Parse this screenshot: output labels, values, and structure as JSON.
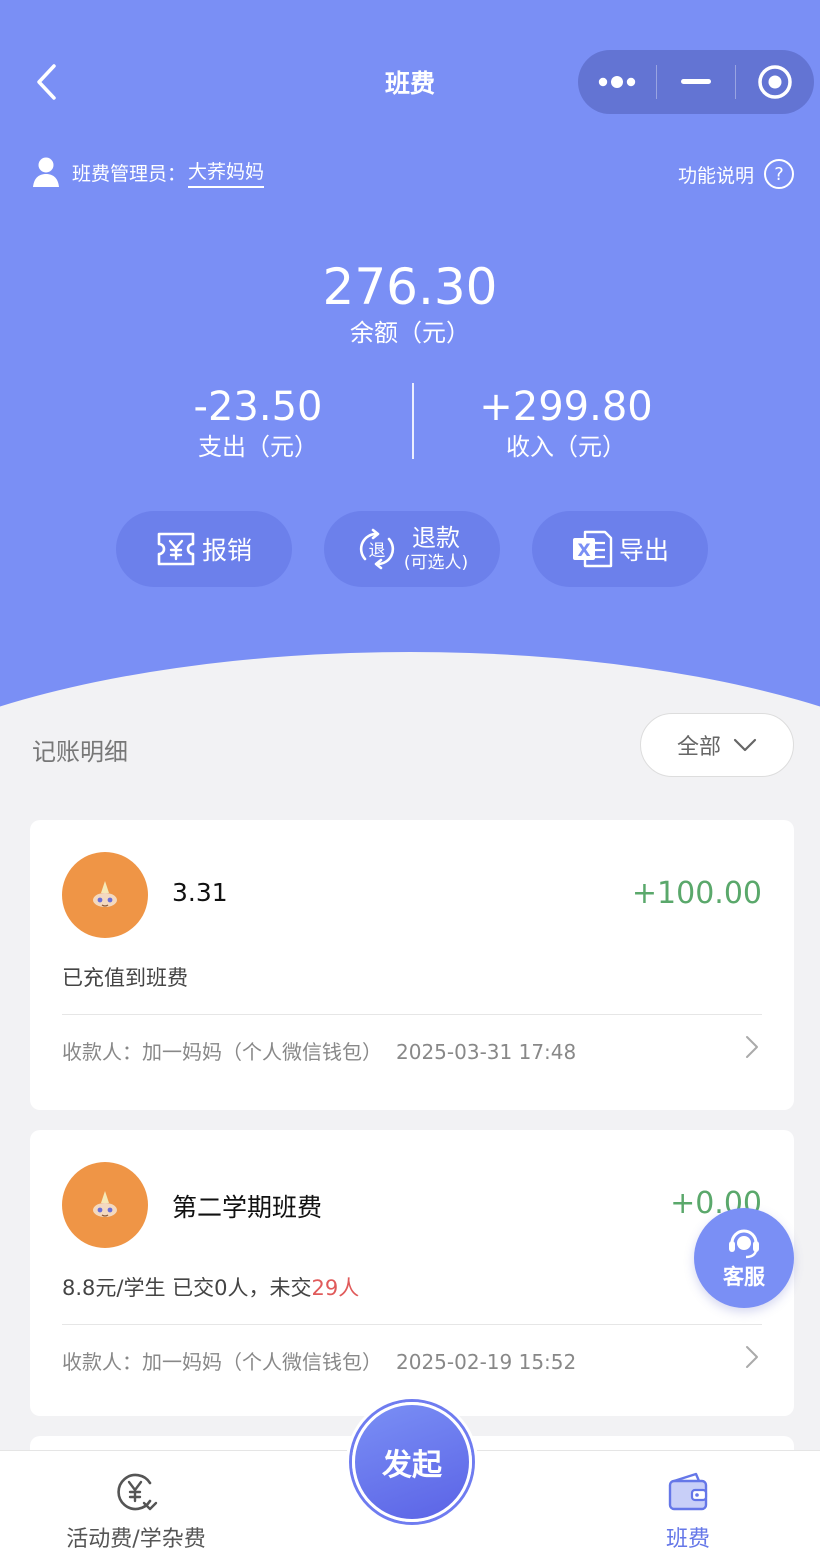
{
  "nav": {
    "title": "班费"
  },
  "admin": {
    "label": "班费管理员：",
    "name": "大荞妈妈",
    "help_label": "功能说明",
    "help_icon_text": "?"
  },
  "summary": {
    "balance": "276.30",
    "balance_label": "余额（元）",
    "expense": "-23.50",
    "expense_label": "支出（元）",
    "income": "+299.80",
    "income_label": "收入（元）"
  },
  "actions": {
    "reimburse": "报销",
    "refund": "退款",
    "refund_sub": "(可选人)",
    "refund_icon_text": "退",
    "export": "导出",
    "export_icon_text": "X"
  },
  "section": {
    "title": "记账明细",
    "filter": "全部"
  },
  "records": [
    {
      "title": "3.31",
      "amount": "+100.00",
      "desc": "已充值到班费",
      "payee": "收款人：加一妈妈（个人微信钱包）",
      "date": "2025-03-31 17:48"
    },
    {
      "title": "第二学期班费",
      "amount": "+0.00",
      "desc_prefix": "8.8元/学生 已交0人，未交",
      "desc_highlight": "29人",
      "payee": "收款人：加一妈妈（个人微信钱包）",
      "date": "2025-02-19 15:52"
    }
  ],
  "float_service": {
    "label": "客服"
  },
  "tabbar": {
    "activity": "活动费/学杂费",
    "launch": "发起",
    "classfee": "班费"
  },
  "colors": {
    "primary": "#7a8ff5",
    "income_green": "#5aa86b",
    "alert_red": "#e05a5a",
    "avatar_orange": "#ef9546"
  }
}
